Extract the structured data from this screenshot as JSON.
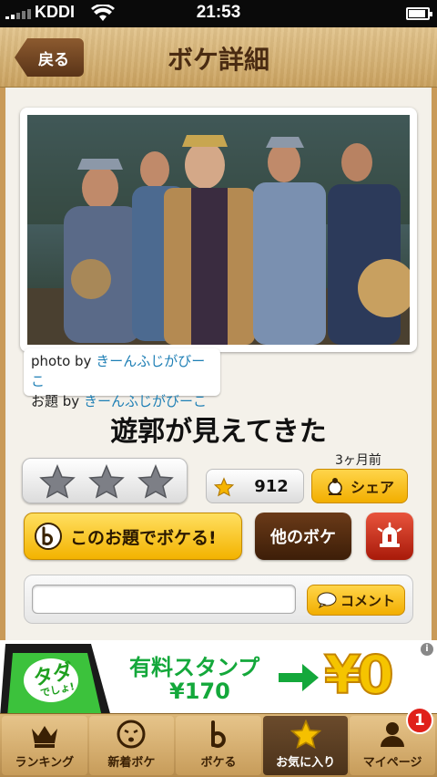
{
  "status_bar": {
    "carrier": "KDDI",
    "time": "21:53"
  },
  "nav": {
    "back_label": "戻る",
    "title": "ボケ詳細"
  },
  "photo": {
    "photo_by_prefix": "photo by",
    "photo_by_name": "きーんふじがびーこ",
    "odai_by_prefix": "お題 by",
    "odai_by_name": "きーんふじがびーこ"
  },
  "boke": {
    "text": "遊郭が見えてきた",
    "timestamp": "3ヶ月前"
  },
  "actions": {
    "rating_stars": 3,
    "favorite_count": "912",
    "share_label": "シェア",
    "boke_label": "このお題でボケる!",
    "other_boke_label": "他のボケ",
    "comment_label": "コメント",
    "comment_placeholder": ""
  },
  "ad": {
    "title": "有料スタンプ",
    "price": "¥170",
    "promo": "¥0",
    "phone_text_main": "タダ",
    "phone_text_sub": "でしょ!",
    "info_icon": "i"
  },
  "tabs": [
    {
      "label": "ランキング",
      "icon": "crown-icon",
      "active": false
    },
    {
      "label": "新着ボケ",
      "icon": "face-icon",
      "active": false
    },
    {
      "label": "ボケる",
      "icon": "boke-b-icon",
      "active": false
    },
    {
      "label": "お気に入り",
      "icon": "star-icon",
      "active": true
    },
    {
      "label": "マイページ",
      "icon": "person-icon",
      "active": false,
      "badge": "1"
    }
  ],
  "colors": {
    "accent_yellow": "#f3b300",
    "wood": "#d4b072",
    "link_blue": "#1e7fb5",
    "ad_green": "#14a83b"
  }
}
